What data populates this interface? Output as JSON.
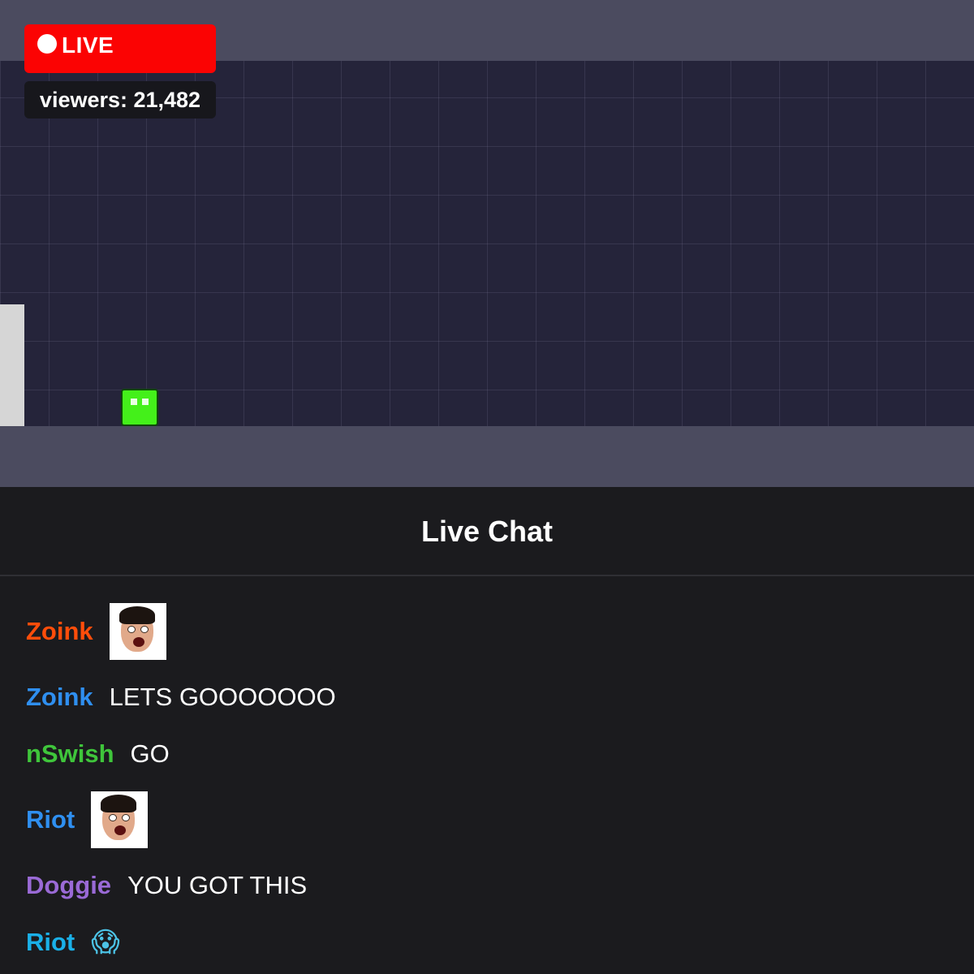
{
  "stream": {
    "live_label": "LIVE",
    "viewers_text": "viewers: 21,482"
  },
  "chat": {
    "title": "Live Chat",
    "messages": [
      {
        "user": "Zoink",
        "color": "#ff4d0a",
        "type": "emote",
        "emote": "pogchamp-emote",
        "text": ""
      },
      {
        "user": "Zoink",
        "color": "#2f8ff0",
        "type": "text",
        "text": "LETS GOOOOOOO"
      },
      {
        "user": "nSwish",
        "color": "#3fc53b",
        "type": "text",
        "text": "GO"
      },
      {
        "user": "Riot",
        "color": "#2f8ff0",
        "type": "emote",
        "emote": "pogchamp-emote",
        "text": ""
      },
      {
        "user": "Doggie",
        "color": "#9a6ad6",
        "type": "text",
        "text": "YOU GOT THIS"
      },
      {
        "user": "Riot",
        "color": "#1ab0e8",
        "type": "emoji",
        "text": "😱"
      }
    ]
  }
}
